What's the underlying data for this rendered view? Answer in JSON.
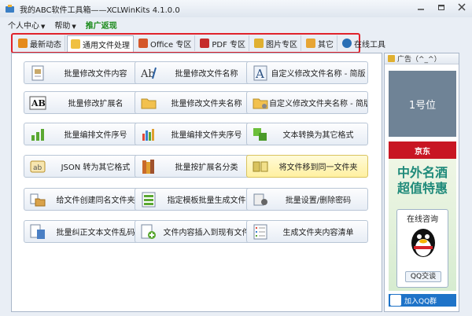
{
  "window": {
    "title": "我的ABC软件工具箱——XCLWinKits  4.1.0.0"
  },
  "menu": [
    {
      "label": "个人中心",
      "caret": true,
      "green": false
    },
    {
      "label": "帮助",
      "caret": true,
      "green": false
    },
    {
      "label": "推广返现",
      "caret": false,
      "green": true
    }
  ],
  "tabs": [
    {
      "label": "最新动态",
      "icon": "rss-icon",
      "color": "#e58b1c"
    },
    {
      "label": "通用文件处理",
      "icon": "folder-icon",
      "color": "#f0c040",
      "active": true
    },
    {
      "label": "Office 专区",
      "icon": "office-icon",
      "color": "#d4572a"
    },
    {
      "label": "PDF 专区",
      "icon": "pdf-icon",
      "color": "#c52b2b"
    },
    {
      "label": "图片专区",
      "icon": "image-icon",
      "color": "#e0b030"
    },
    {
      "label": "其它",
      "icon": "note-icon",
      "color": "#e7a534"
    },
    {
      "label": "在线工具",
      "icon": "globe-icon",
      "color": "#2a6fb5"
    }
  ],
  "tools": [
    {
      "label": "批量修改文件内容",
      "icon": "document-edit-icon"
    },
    {
      "label": "批量修改文件名称",
      "icon": "text-edit-icon"
    },
    {
      "label": "自定义修改文件名称 - 简版",
      "icon": "letter-a-icon"
    },
    {
      "label": "批量修改扩展名",
      "icon": "ab-icon"
    },
    {
      "label": "批量修改文件夹名称",
      "icon": "folder-open-icon"
    },
    {
      "label": "自定义修改文件夹名称 - 简版",
      "icon": "folder-gear-icon"
    },
    {
      "label": "批量编排文件序号",
      "icon": "bar-chart-icon"
    },
    {
      "label": "批量编排文件夹序号",
      "icon": "chart-color-icon"
    },
    {
      "label": "文本转换为其它格式",
      "icon": "convert-icon"
    },
    {
      "label": "JSON 转为其它格式",
      "icon": "json-icon"
    },
    {
      "label": "批量按扩展名分类",
      "icon": "books-icon"
    },
    {
      "label": "将文件移到同一文件夹",
      "icon": "move-files-icon",
      "highlight": true
    },
    {
      "label": "给文件创建同名文件夹",
      "icon": "folder-create-icon"
    },
    {
      "label": "指定模板批量生成文件",
      "icon": "template-icon"
    },
    {
      "label": "批量设置/删除密码",
      "icon": "password-icon"
    },
    {
      "label": "批量纠正文本文件乱码",
      "icon": "fix-text-icon"
    },
    {
      "label": "文件内容插入到现有文件",
      "icon": "insert-icon"
    },
    {
      "label": "生成文件夹内容清单",
      "icon": "list-icon"
    }
  ],
  "ad": {
    "header": "广告（^_^）",
    "slot_label": "1号位",
    "jd_label": "京东",
    "line1": "中外名酒",
    "line2": "超值特惠",
    "qq_title": "在线咨询",
    "qq_button": "QQ交谈",
    "qq_group": "加入QQ群"
  },
  "window_buttons": [
    "minimize",
    "restore",
    "close"
  ]
}
